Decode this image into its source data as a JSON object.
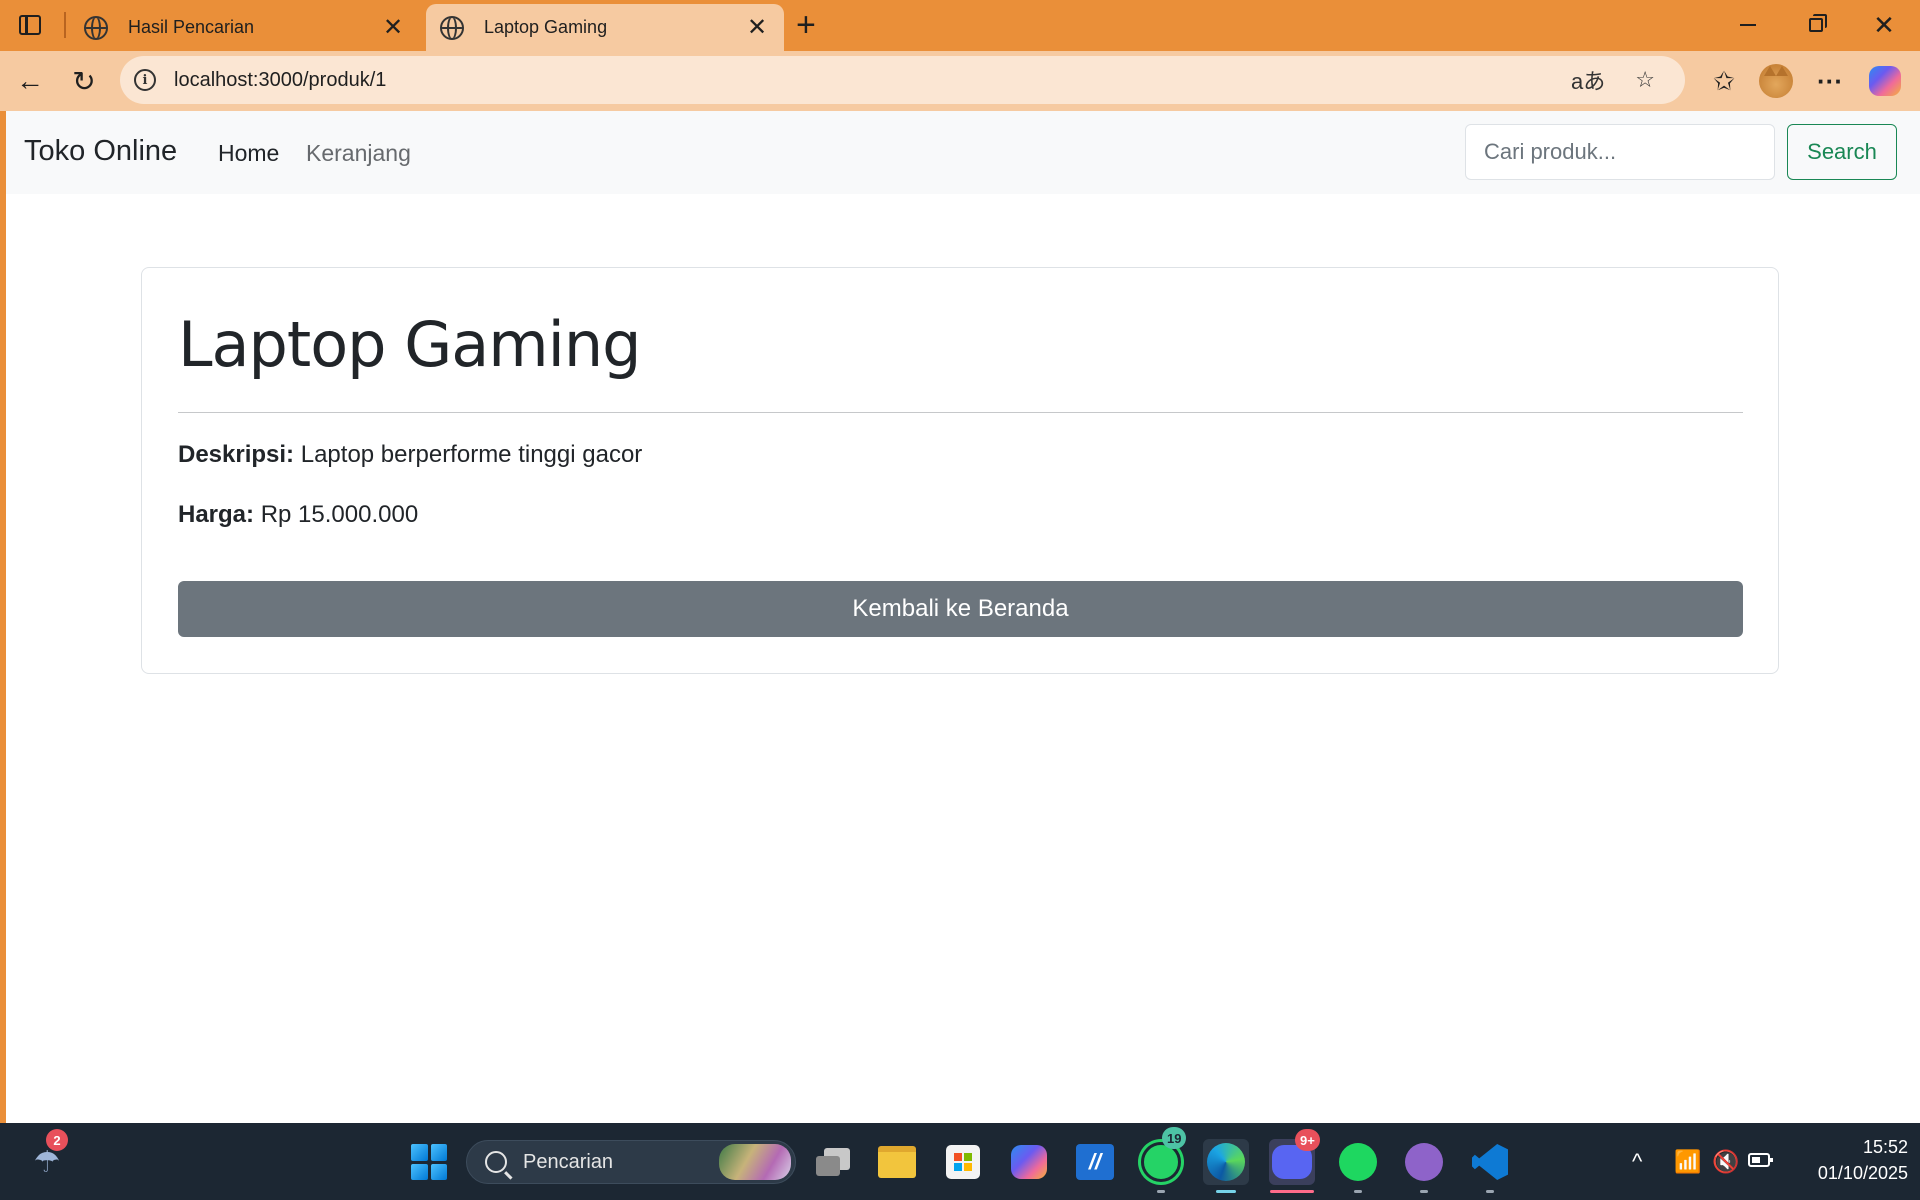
{
  "browser": {
    "tabs": [
      {
        "title": "Hasil Pencarian",
        "icon": "globe-icon",
        "active": false
      },
      {
        "title": "Laptop Gaming",
        "icon": "globe-icon",
        "active": true
      }
    ],
    "close_glyph": "✕",
    "new_tab_glyph": "+",
    "window_close_glyph": "✕",
    "url": "localhost:3000/produk/1",
    "back_glyph": "←",
    "reload_glyph": "↻",
    "read_aloud_glyph": "aあ",
    "favorite_glyph": "☆",
    "favorites_glyph": "✩",
    "more_glyph": "···"
  },
  "navbar": {
    "brand": "Toko Online",
    "links": [
      "Home",
      "Keranjang"
    ],
    "search_placeholder": "Cari produk...",
    "search_button": "Search"
  },
  "product": {
    "title": "Laptop Gaming",
    "description_label": "Deskripsi:",
    "description": "Laptop berperforme tinggi gacor",
    "price_label": "Harga:",
    "price": "Rp 15.000.000",
    "back_button": "Kembali ke Beranda"
  },
  "taskbar": {
    "weather_badge": "2",
    "search_label": "Pencarian",
    "whatsapp_badge": "19",
    "discord_badge": "9+",
    "chevron_glyph": "^",
    "wifi_glyph": "📶",
    "sound_glyph": "🔇",
    "time": "15:52",
    "date": "01/10/2025"
  },
  "colors": {
    "title_bar": "#ea8f39",
    "active_tab": "#f6caa1",
    "navbar_bg": "#f8f9fa",
    "search_button_accent": "#198754",
    "back_button_bg": "#6c757d",
    "taskbar_bg": "#1c2733"
  }
}
